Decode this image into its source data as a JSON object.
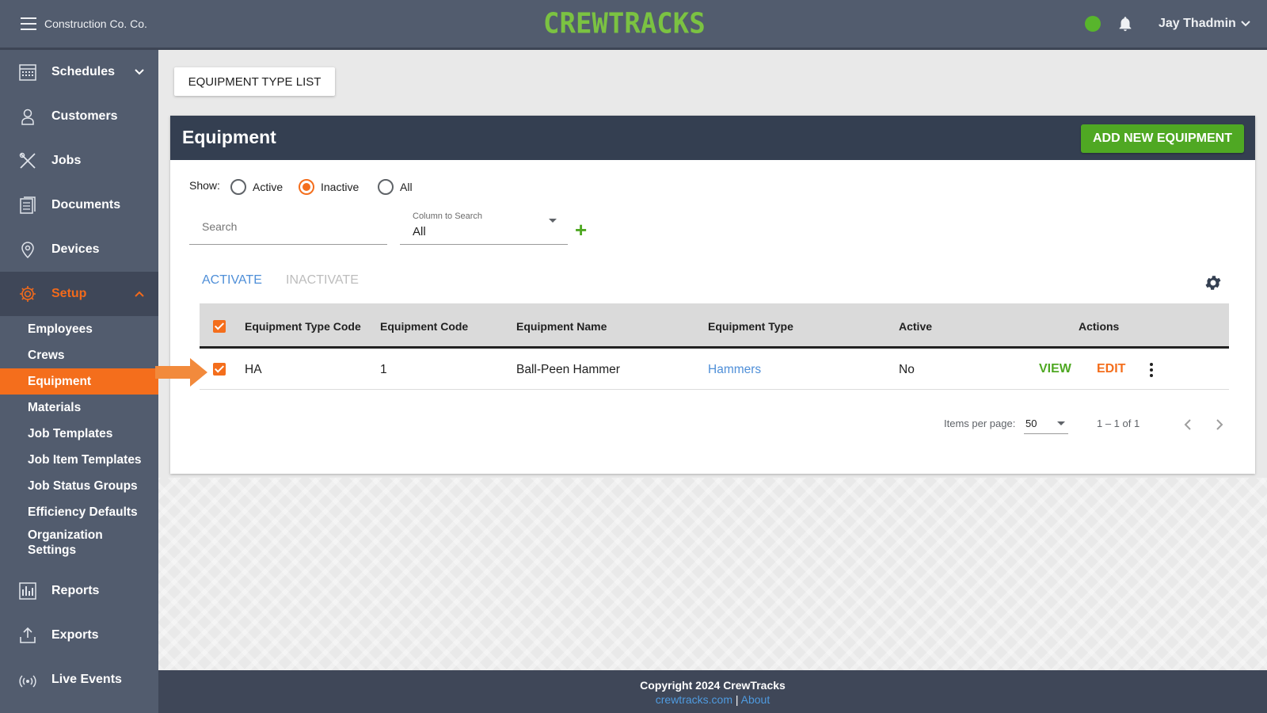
{
  "topbar": {
    "company": "Construction Co. Co.",
    "logo": "CREWTRACKS",
    "user": "Jay Thadmin",
    "status_color": "#58b52c"
  },
  "sidebar": {
    "items": [
      {
        "label": "Schedules",
        "icon": "calendar-icon"
      },
      {
        "label": "Customers",
        "icon": "customer-icon"
      },
      {
        "label": "Jobs",
        "icon": "tools-icon"
      },
      {
        "label": "Documents",
        "icon": "documents-icon"
      },
      {
        "label": "Devices",
        "icon": "location-pin-icon"
      },
      {
        "label": "Setup",
        "icon": "gear-icon"
      }
    ],
    "setup_items": [
      "Employees",
      "Crews",
      "Equipment",
      "Materials",
      "Job Templates",
      "Job Item Templates",
      "Job Status Groups",
      "Efficiency Defaults",
      "Organization Settings"
    ],
    "bottom_items": [
      {
        "label": "Reports",
        "icon": "bar-chart-icon"
      },
      {
        "label": "Exports",
        "icon": "upload-icon"
      },
      {
        "label": "Live Events",
        "icon": "broadcast-icon"
      }
    ]
  },
  "main": {
    "type_list_button": "EQUIPMENT TYPE LIST",
    "title": "Equipment",
    "add_button": "ADD NEW EQUIPMENT",
    "show_label": "Show:",
    "filters": [
      "Active",
      "Inactive",
      "All"
    ],
    "selected_filter": "Inactive",
    "search_placeholder": "Search",
    "column_search_label": "Column to Search",
    "column_search_value": "All",
    "activate": "ACTIVATE",
    "inactivate": "INACTIVATE",
    "columns": [
      "Equipment Type Code",
      "Equipment Code",
      "Equipment Name",
      "Equipment Type",
      "Active",
      "Actions"
    ],
    "rows": [
      {
        "type_code": "HA",
        "code": "1",
        "name": "Ball-Peen Hammer",
        "type": "Hammers",
        "active": "No",
        "view": "VIEW",
        "edit": "EDIT"
      }
    ],
    "items_per_page_label": "Items per page:",
    "items_per_page": "50",
    "range": "1 – 1 of 1"
  },
  "footer": {
    "copyright": "Copyright 2024 CrewTracks",
    "site_link": "crewtracks.com",
    "separator": "|",
    "about_link": "About"
  },
  "colors": {
    "accent": "#f46e1c",
    "green": "#4fa823",
    "nav": "#525c6e",
    "header": "#343f51"
  }
}
